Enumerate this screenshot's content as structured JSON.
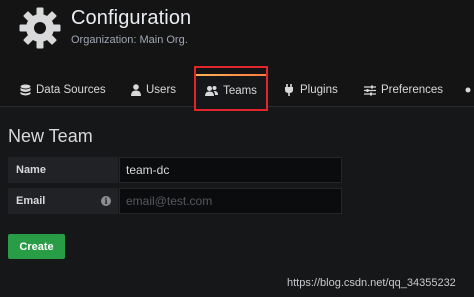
{
  "header": {
    "title": "Configuration",
    "subtitle": "Organization: Main Org."
  },
  "tabs": [
    {
      "label": "Data Sources",
      "icon": "database-icon",
      "active": false
    },
    {
      "label": "Users",
      "icon": "user-icon",
      "active": false
    },
    {
      "label": "Teams",
      "icon": "users-icon",
      "active": true
    },
    {
      "label": "Plugins",
      "icon": "plug-icon",
      "active": false
    },
    {
      "label": "Preferences",
      "icon": "sliders-icon",
      "active": false
    }
  ],
  "form": {
    "title": "New Team",
    "name_label": "Name",
    "name_value": "team-dc",
    "email_label": "Email",
    "email_placeholder": "email@test.com",
    "info_glyph": "i",
    "create_label": "Create"
  },
  "watermark": "https://blog.csdn.net/qq_34355232",
  "colors": {
    "background": "#161719",
    "header_bg": "#141414",
    "active_tab_gradient": [
      "#ffb357",
      "#ff7941"
    ],
    "highlight_box": "#e0262a",
    "create_button": "#299c46"
  }
}
